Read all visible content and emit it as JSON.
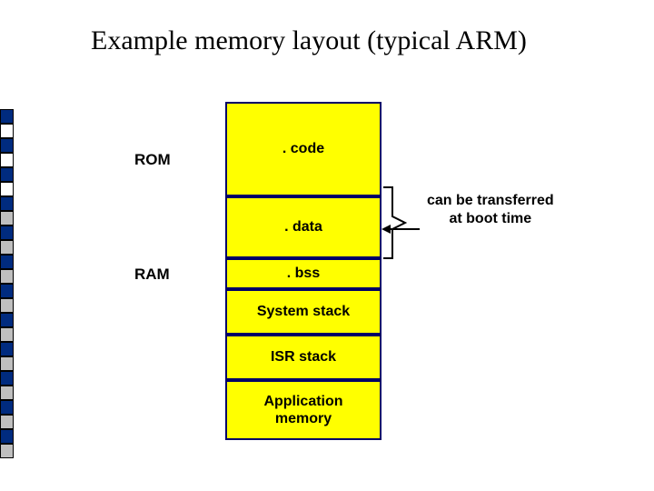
{
  "title": "Example memory layout (typical ARM)",
  "labels": {
    "rom": "ROM",
    "ram": "RAM"
  },
  "cells": {
    "code": ". code",
    "data": ". data",
    "bss": ". bss",
    "system_stack": "System stack",
    "isr_stack": "ISR stack",
    "app_mem": "Application\nmemory"
  },
  "note": "can be transferred\nat boot time",
  "colors": {
    "cell_fill": "#ffff00",
    "cell_border": "#000066",
    "sidebar_pattern": [
      "#002b7f",
      "#ffffff",
      "#002b7f",
      "#ffffff",
      "#002b7f",
      "#ffffff",
      "#002b7f",
      "#bfbfbf",
      "#002b7f",
      "#bfbfbf",
      "#002b7f",
      "#bfbfbf",
      "#002b7f",
      "#bfbfbf",
      "#002b7f",
      "#bfbfbf",
      "#002b7f",
      "#bfbfbf",
      "#002b7f",
      "#bfbfbf",
      "#002b7f",
      "#bfbfbf",
      "#002b7f",
      "#bfbfbf"
    ]
  }
}
